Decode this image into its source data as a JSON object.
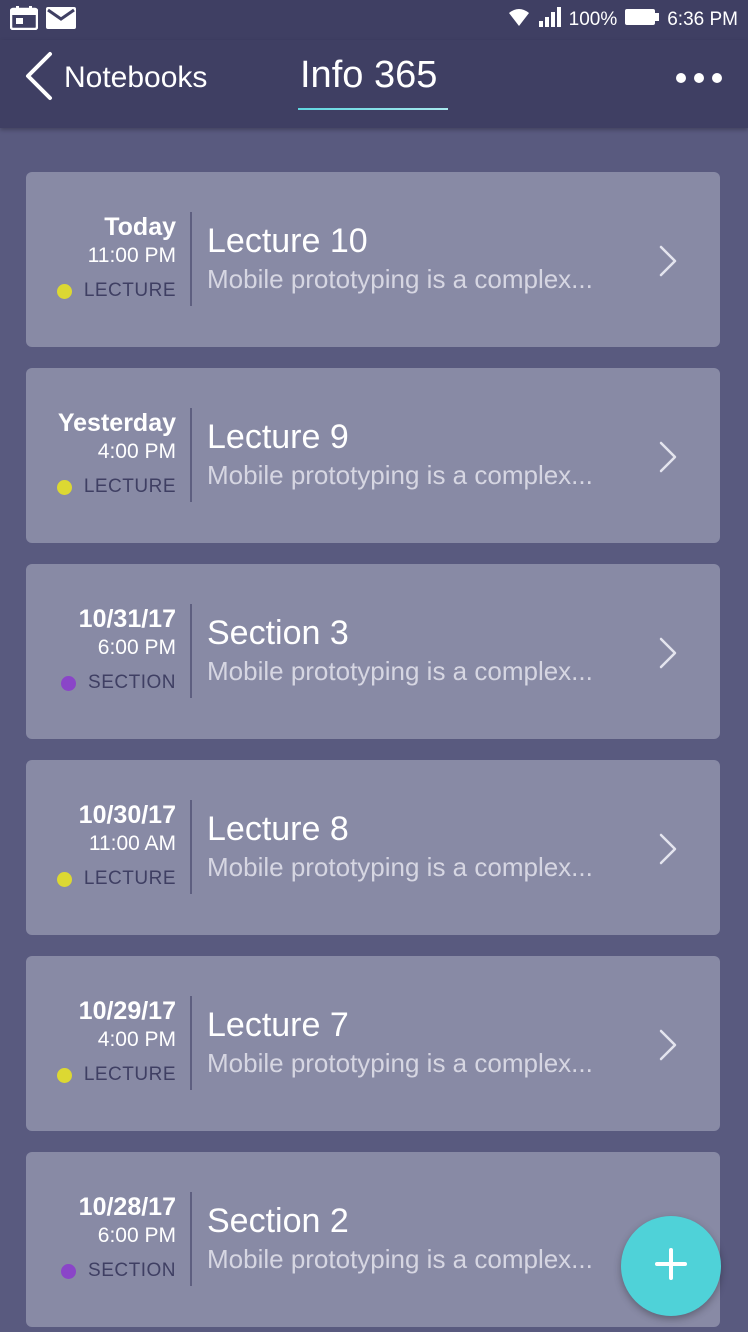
{
  "status_bar": {
    "battery_text": "100%",
    "time": "6:36 PM",
    "icons": [
      "calendar-icon",
      "mail-icon",
      "wifi-icon",
      "signal-icon",
      "battery-icon"
    ]
  },
  "header": {
    "back_label": "Notebooks",
    "title": "Info 365",
    "more_icon": "more-icon"
  },
  "colors": {
    "header_bg": "#3f3f63",
    "background": "#595a7f",
    "card_bg": "#888aa5",
    "lecture_dot": "#dcd832",
    "section_dot": "#8a45c8",
    "fab": "#4fd2d8"
  },
  "notes": [
    {
      "date": "Today",
      "time": "11:00 PM",
      "type": "LECTURE",
      "title": "Lecture 10",
      "preview": "Mobile prototyping is a complex..."
    },
    {
      "date": "Yesterday",
      "time": "4:00 PM",
      "type": "LECTURE",
      "title": "Lecture 9",
      "preview": "Mobile prototyping is a complex..."
    },
    {
      "date": "10/31/17",
      "time": "6:00 PM",
      "type": "SECTION",
      "title": "Section 3",
      "preview": "Mobile prototyping is a complex..."
    },
    {
      "date": "10/30/17",
      "time": "11:00 AM",
      "type": "LECTURE",
      "title": "Lecture 8",
      "preview": "Mobile prototyping is a complex..."
    },
    {
      "date": "10/29/17",
      "time": "4:00 PM",
      "type": "LECTURE",
      "title": "Lecture 7",
      "preview": "Mobile prototyping is a complex..."
    },
    {
      "date": "10/28/17",
      "time": "6:00 PM",
      "type": "SECTION",
      "title": "Section 2",
      "preview": "Mobile prototyping is a complex..."
    }
  ],
  "fab": {
    "icon": "plus-icon"
  }
}
